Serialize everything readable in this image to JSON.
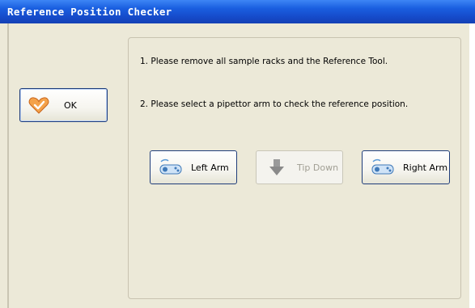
{
  "window": {
    "title": "Reference Position Checker"
  },
  "left": {
    "ok_label": "OK"
  },
  "instructions": {
    "line1": "1. Please remove all sample racks and the Reference Tool.",
    "line2": "2. Please select a pipettor arm to check the reference position."
  },
  "buttons": {
    "left_arm": "Left Arm",
    "tip_down": "Tip Down",
    "right_arm": "Right Arm"
  },
  "icons": {
    "ok": "heart-check-icon",
    "left_arm": "arm-icon",
    "tip_down": "down-arrow-icon",
    "right_arm": "arm-icon"
  },
  "colors": {
    "titlebar": "#1a5fe0",
    "background": "#ece9d8",
    "button_border": "#1f3d7a",
    "disabled_text": "#a19f94"
  },
  "states": {
    "tip_down_enabled": false
  }
}
